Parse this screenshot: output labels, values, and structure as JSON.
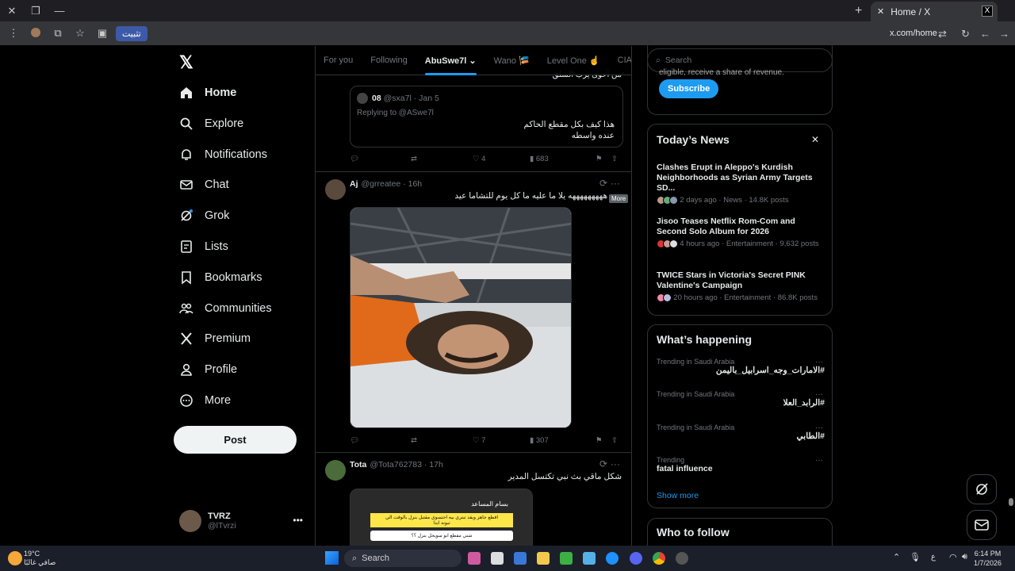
{
  "browser": {
    "tab_title": "Home / X",
    "install_label": "تثبيت",
    "url": "x.com/home"
  },
  "nav": {
    "items": [
      {
        "label": "Home",
        "icon": "home-icon"
      },
      {
        "label": "Explore",
        "icon": "search-icon"
      },
      {
        "label": "Notifications",
        "icon": "bell-icon"
      },
      {
        "label": "Chat",
        "icon": "mail-icon"
      },
      {
        "label": "Grok",
        "icon": "grok-icon"
      },
      {
        "label": "Lists",
        "icon": "list-icon"
      },
      {
        "label": "Bookmarks",
        "icon": "bookmark-icon"
      },
      {
        "label": "Communities",
        "icon": "people-icon"
      },
      {
        "label": "Premium",
        "icon": "x-icon"
      },
      {
        "label": "Profile",
        "icon": "person-icon"
      },
      {
        "label": "More",
        "icon": "more-circle-icon"
      }
    ],
    "post_label": "Post",
    "account": {
      "name": "TVRZ",
      "handle": "@lTvrzi"
    }
  },
  "feed": {
    "tabs": [
      "For you",
      "Following",
      "AbuSwe7l",
      "Wano 🎏",
      "Level One ☝",
      "CIA ALI"
    ],
    "first_tweet": {
      "top_text": "من اخوى يرب الشلق",
      "quote": {
        "name": "08",
        "handle": "@sxa7l",
        "date": "Jan 5",
        "replying": "Replying to @ASwe7l",
        "text_line1": "هذا كيف بكل مقطع الحاكم",
        "text_line2": "عنده واسطه"
      },
      "likes": "4",
      "views": "683"
    },
    "second_tweet": {
      "name": "Aj",
      "handle": "@grreatee",
      "time": "16h",
      "text": "هههههههههه يلا ما عليه ما كل يوم للتشاما عيد",
      "more_tip": "More",
      "likes": "7",
      "views": "307"
    },
    "third_tweet": {
      "name": "Tota",
      "handle": "@Tota762783",
      "time": "17h",
      "text": "شكل ماقي بث نبي تكتسل المدير",
      "media_name": "بسام المساعد",
      "media_line1": "اقطع جاهز ويقد تبتري بيه احتسوي مقتبل بنزل بالوقت الي",
      "media_line2": "تبونه ابدا",
      "media_line3": "شتي مقطع ابو سويحل بنزل ؟؟"
    }
  },
  "sidebar": {
    "search_placeholder": "Search",
    "premium_text": "eligible, receive a share of revenue.",
    "subscribe_label": "Subscribe",
    "news": {
      "title": "Today’s News",
      "items": [
        {
          "title": "Clashes Erupt in Aleppo's Kurdish Neighborhoods as Syrian Army Targets SD...",
          "meta": "2 days ago · News · 14.8K posts"
        },
        {
          "title": "Jisoo Teases Netflix Rom-Com and Second Solo Album for 2026",
          "meta": "4 hours ago · Entertainment · 9,632 posts"
        },
        {
          "title": "TWICE Stars in Victoria's Secret PINK Valentine's Campaign",
          "meta": "20 hours ago · Entertainment · 86.8K posts"
        }
      ]
    },
    "happening": {
      "title": "What’s happening",
      "trends": [
        {
          "meta": "Trending in Saudi Arabia",
          "name": "#الامارات_وجه_اسرابيل_باليمن"
        },
        {
          "meta": "Trending in Saudi Arabia",
          "name": "#الرابد_العلا"
        },
        {
          "meta": "Trending in Saudi Arabia",
          "name": "#الطابي"
        },
        {
          "meta": "Trending",
          "name": "fatal influence"
        }
      ],
      "show_more": "Show more"
    },
    "who_to_follow": "Who to follow"
  },
  "taskbar": {
    "temp": "19°C",
    "weather_text": "صافي غالبًا",
    "search_label": "Search",
    "time": "6:14 PM",
    "date": "1/7/2026",
    "lang": "ع"
  }
}
